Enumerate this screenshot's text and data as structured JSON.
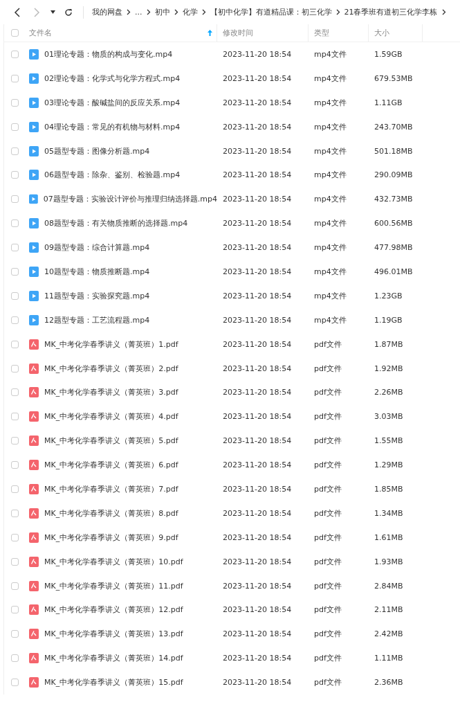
{
  "toolbar": {
    "breadcrumbs": [
      "我的网盘",
      "...",
      "初中",
      "化学",
      "【初中化学】有道精品课：初三化学",
      "21春季班有道初三化学李栋"
    ]
  },
  "table": {
    "columns": [
      {
        "label": "文件名",
        "sorted": true
      },
      {
        "label": "修改时间",
        "sorted": false
      },
      {
        "label": "类型",
        "sorted": false
      },
      {
        "label": "大小",
        "sorted": false
      }
    ],
    "all_checked": false,
    "rows": [
      {
        "kind": "video",
        "name": "01理论专题：物质的构成与变化.mp4",
        "modified": "2023-11-20 18:54",
        "type": "mp4文件",
        "size": "1.59GB",
        "checked": false
      },
      {
        "kind": "video",
        "name": "02理论专题：化学式与化学方程式.mp4",
        "modified": "2023-11-20 18:54",
        "type": "mp4文件",
        "size": "679.53MB",
        "checked": false
      },
      {
        "kind": "video",
        "name": "03理论专题：酸碱盐间的反应关系.mp4",
        "modified": "2023-11-20 18:54",
        "type": "mp4文件",
        "size": "1.11GB",
        "checked": false
      },
      {
        "kind": "video",
        "name": "04理论专题：常见的有机物与材料.mp4",
        "modified": "2023-11-20 18:54",
        "type": "mp4文件",
        "size": "243.70MB",
        "checked": false
      },
      {
        "kind": "video",
        "name": "05题型专题：图像分析题.mp4",
        "modified": "2023-11-20 18:54",
        "type": "mp4文件",
        "size": "501.18MB",
        "checked": false
      },
      {
        "kind": "video",
        "name": "06题型专题：除杂、鉴别、检验题.mp4",
        "modified": "2023-11-20 18:54",
        "type": "mp4文件",
        "size": "290.09MB",
        "checked": false
      },
      {
        "kind": "video",
        "name": "07题型专题：实验设计评价与推理归纳选择题.mp4",
        "modified": "2023-11-20 18:54",
        "type": "mp4文件",
        "size": "432.73MB",
        "checked": false
      },
      {
        "kind": "video",
        "name": "08题型专题：有关物质推断的选择题.mp4",
        "modified": "2023-11-20 18:54",
        "type": "mp4文件",
        "size": "600.56MB",
        "checked": false
      },
      {
        "kind": "video",
        "name": "09题型专题：综合计算题.mp4",
        "modified": "2023-11-20 18:54",
        "type": "mp4文件",
        "size": "477.98MB",
        "checked": false
      },
      {
        "kind": "video",
        "name": "10题型专题：物质推断题.mp4",
        "modified": "2023-11-20 18:54",
        "type": "mp4文件",
        "size": "496.01MB",
        "checked": false
      },
      {
        "kind": "video",
        "name": "11题型专题：实验探究题.mp4",
        "modified": "2023-11-20 18:54",
        "type": "mp4文件",
        "size": "1.23GB",
        "checked": false
      },
      {
        "kind": "video",
        "name": "12题型专题：工艺流程题.mp4",
        "modified": "2023-11-20 18:54",
        "type": "mp4文件",
        "size": "1.19GB",
        "checked": false
      },
      {
        "kind": "pdf",
        "name": "MK_中考化学春季讲义（菁英班）1.pdf",
        "modified": "2023-11-20 18:54",
        "type": "pdf文件",
        "size": "1.87MB",
        "checked": false
      },
      {
        "kind": "pdf",
        "name": "MK_中考化学春季讲义（菁英班）2.pdf",
        "modified": "2023-11-20 18:54",
        "type": "pdf文件",
        "size": "1.92MB",
        "checked": false
      },
      {
        "kind": "pdf",
        "name": "MK_中考化学春季讲义（菁英班）3.pdf",
        "modified": "2023-11-20 18:54",
        "type": "pdf文件",
        "size": "2.26MB",
        "checked": false
      },
      {
        "kind": "pdf",
        "name": "MK_中考化学春季讲义（菁英班）4.pdf",
        "modified": "2023-11-20 18:54",
        "type": "pdf文件",
        "size": "3.03MB",
        "checked": false
      },
      {
        "kind": "pdf",
        "name": "MK_中考化学春季讲义（菁英班）5.pdf",
        "modified": "2023-11-20 18:54",
        "type": "pdf文件",
        "size": "1.55MB",
        "checked": false
      },
      {
        "kind": "pdf",
        "name": "MK_中考化学春季讲义（菁英班）6.pdf",
        "modified": "2023-11-20 18:54",
        "type": "pdf文件",
        "size": "1.29MB",
        "checked": false
      },
      {
        "kind": "pdf",
        "name": "MK_中考化学春季讲义（菁英班）7.pdf",
        "modified": "2023-11-20 18:54",
        "type": "pdf文件",
        "size": "1.85MB",
        "checked": false
      },
      {
        "kind": "pdf",
        "name": "MK_中考化学春季讲义（菁英班）8.pdf",
        "modified": "2023-11-20 18:54",
        "type": "pdf文件",
        "size": "1.34MB",
        "checked": false
      },
      {
        "kind": "pdf",
        "name": "MK_中考化学春季讲义（菁英班）9.pdf",
        "modified": "2023-11-20 18:54",
        "type": "pdf文件",
        "size": "1.61MB",
        "checked": false
      },
      {
        "kind": "pdf",
        "name": "MK_中考化学春季讲义（菁英班）10.pdf",
        "modified": "2023-11-20 18:54",
        "type": "pdf文件",
        "size": "1.93MB",
        "checked": false
      },
      {
        "kind": "pdf",
        "name": "MK_中考化学春季讲义（菁英班）11.pdf",
        "modified": "2023-11-20 18:54",
        "type": "pdf文件",
        "size": "2.84MB",
        "checked": false
      },
      {
        "kind": "pdf",
        "name": "MK_中考化学春季讲义（菁英班）12.pdf",
        "modified": "2023-11-20 18:54",
        "type": "pdf文件",
        "size": "2.11MB",
        "checked": false
      },
      {
        "kind": "pdf",
        "name": "MK_中考化学春季讲义（菁英班）13.pdf",
        "modified": "2023-11-20 18:54",
        "type": "pdf文件",
        "size": "2.42MB",
        "checked": false
      },
      {
        "kind": "pdf",
        "name": "MK_中考化学春季讲义（菁英班）14.pdf",
        "modified": "2023-11-20 18:54",
        "type": "pdf文件",
        "size": "1.11MB",
        "checked": false
      },
      {
        "kind": "pdf",
        "name": "MK_中考化学春季讲义（菁英班）15.pdf",
        "modified": "2023-11-20 18:54",
        "type": "pdf文件",
        "size": "2.36MB",
        "checked": false
      }
    ]
  }
}
